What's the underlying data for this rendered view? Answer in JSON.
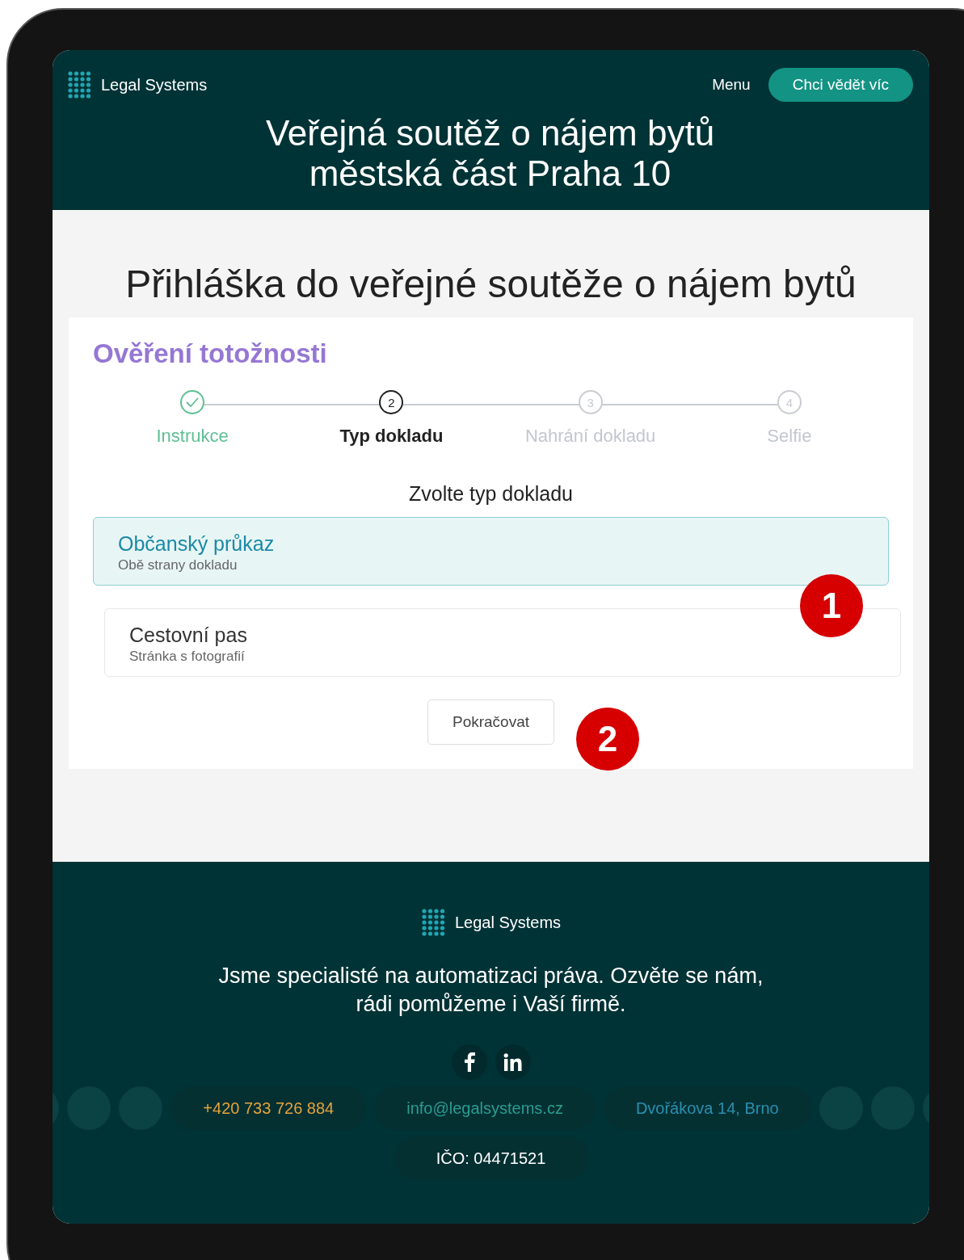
{
  "header": {
    "logo": "Legal Systems",
    "menu": "Menu",
    "cta": "Chci vědět víc",
    "title_lines": [
      "Veřejná soutěž o nájem bytů",
      "městská část Praha 10"
    ]
  },
  "page_title": "Přihláška do veřejné soutěže o nájem bytů",
  "card": {
    "title": "Ověření totožnosti",
    "steps": [
      {
        "label": "Instrukce",
        "kind": "done"
      },
      {
        "number": "2",
        "label": "Typ dokladu",
        "kind": "current"
      },
      {
        "number": "3",
        "label": "Nahrání dokladu",
        "kind": "upcoming"
      },
      {
        "number": "4",
        "label": "Selfie",
        "kind": "upcoming"
      }
    ],
    "prompt": "Zvolte typ dokladu",
    "options": [
      {
        "title": "Občanský průkaz",
        "subtitle": "Obě strany dokladu",
        "selected": true
      },
      {
        "title": "Cestovní pas",
        "subtitle": "Stránka s fotografií",
        "selected": false
      }
    ],
    "button": "Pokračovat"
  },
  "annotations": [
    "1",
    "2"
  ],
  "footer": {
    "logo": "Legal Systems",
    "text_lines": [
      "Jsme specialisté na automatizaci práva. Ozvěte se nám,",
      "rádi pomůžeme i Vaší firmě."
    ],
    "social": [
      {
        "kind": "facebook"
      },
      {
        "kind": "linkedin"
      }
    ],
    "contacts": [
      {
        "kind": "phone",
        "text": "+420 733 726 884"
      },
      {
        "kind": "email",
        "text": "info@legalsystems.cz"
      },
      {
        "kind": "address",
        "text": "Dvořákova 14, Brno"
      }
    ],
    "company_id": "IČO: 04471521"
  }
}
